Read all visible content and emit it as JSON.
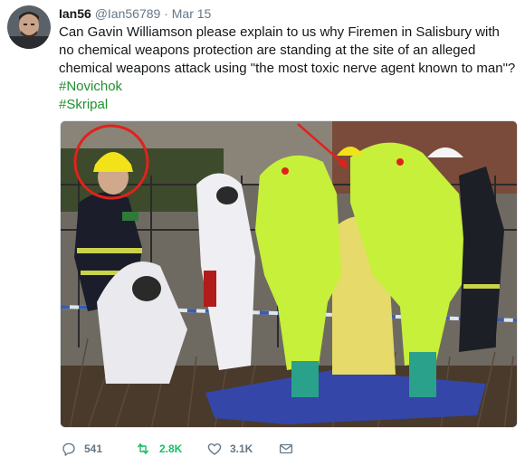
{
  "tweet": {
    "author_name": "Ian56",
    "author_handle": "@Ian56789",
    "separator": "·",
    "date": "Mar 15",
    "text": "Can Gavin Williamson please explain to us why Firemen in Salisbury with no chemical weapons protection are standing at the site of an alleged chemical weapons attack using \"the most toxic nerve agent known to man\"?",
    "hashtags": [
      "#Novichok",
      "#Skripal"
    ]
  },
  "actions": {
    "reply_count": "541",
    "retweet_count": "2.8K",
    "like_count": "3.1K"
  },
  "colors": {
    "hashtag": "#1f8f2f",
    "retweet": "#17bf63",
    "muted": "#657786",
    "annotation_red": "#e0221c",
    "hazmat_suit": "#c7f03a"
  },
  "icons": {
    "reply": "reply-icon",
    "retweet": "retweet-icon",
    "like": "heart-icon",
    "dm": "envelope-icon"
  }
}
